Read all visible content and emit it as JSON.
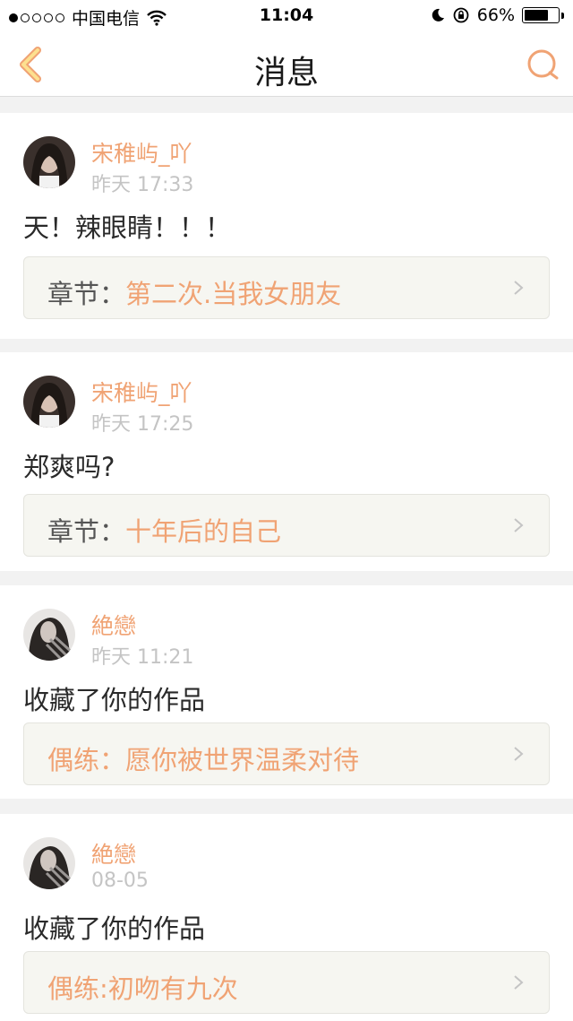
{
  "status_bar": {
    "carrier": "中国电信",
    "time": "11:04",
    "battery": "66%",
    "battery_level": 0.66,
    "signal_bars_filled": 1,
    "signal_bars_total": 5
  },
  "header": {
    "title": "消息"
  },
  "colors": {
    "accent": "#f0a374",
    "text": "#2a2a2a",
    "muted": "#c4c4c4",
    "box_bg": "#f6f6f1"
  },
  "messages": [
    {
      "username": "宋稚屿_吖",
      "time": "昨天 17:33",
      "content": "天！辣眼睛！！！",
      "ref_label": "章节：",
      "ref_value": "第二次.当我女朋友"
    },
    {
      "username": "宋稚屿_吖",
      "time": "昨天 17:25",
      "content": "郑爽吗?",
      "ref_label": "章节：",
      "ref_value": "十年后的自己"
    },
    {
      "username": "絶戀",
      "time": "昨天 11:21",
      "content": "收藏了你的作品",
      "ref_label": "偶练：",
      "ref_value": "愿你被世界温柔对待"
    },
    {
      "username": "絶戀",
      "time": "08-05",
      "content": "收藏了你的作品",
      "ref_label": "偶练:",
      "ref_value": "初吻有九次"
    }
  ]
}
